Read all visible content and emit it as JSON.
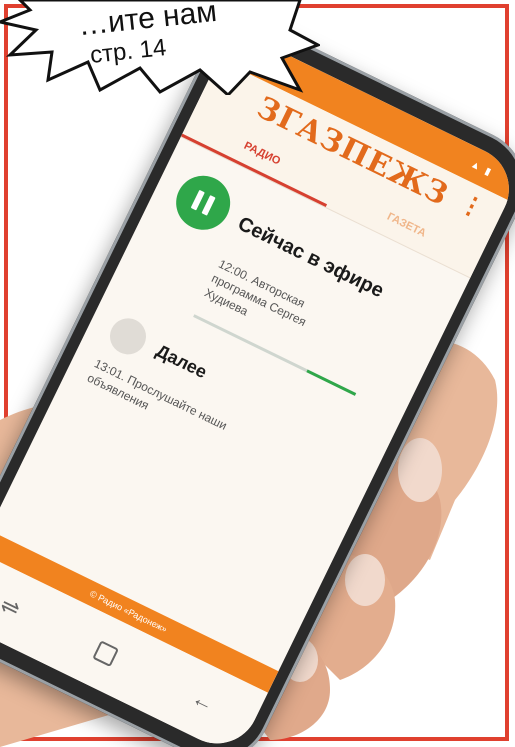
{
  "banner": {
    "line1": "…ите нам",
    "line2": "стр. 14"
  },
  "app": {
    "logo": "ЗГАЗПЕЖЗ",
    "menu_icon": "vertical-dots-icon",
    "tabs": [
      {
        "label": "РАДИО",
        "active": true
      },
      {
        "label": "ГАЗЕТА",
        "active": false
      }
    ],
    "now_playing": {
      "title": "Сейчас в эфире",
      "description": "12:00. Авторская программа Сергея Худиева",
      "progress": 0.3
    },
    "next": {
      "title": "Далее",
      "description": "13:01. Прослушайте наши объявления"
    },
    "bottom_strip": "© Радио «Радонеж»"
  },
  "colors": {
    "accent_orange": "#f1831f",
    "play_green": "#2fa74a",
    "frame_red": "#e0402f"
  }
}
